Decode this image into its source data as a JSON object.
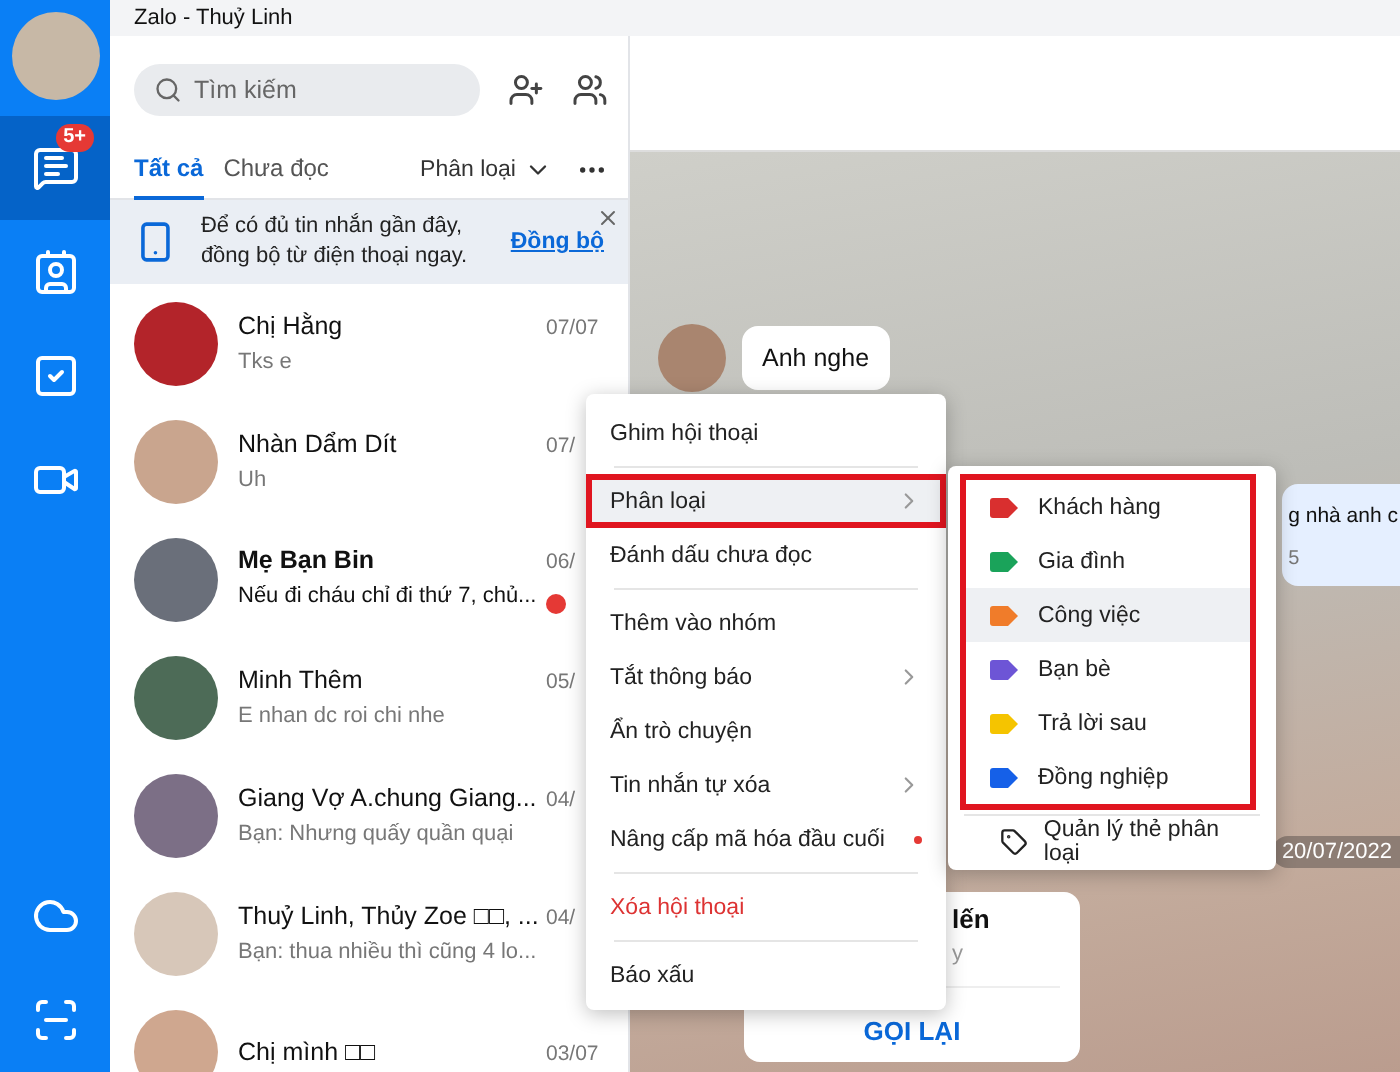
{
  "window": {
    "title": "Zalo - Thuỷ Linh"
  },
  "sidebar": {
    "items": [
      {
        "kind": "chat",
        "selected": true,
        "badge": "5+"
      },
      {
        "kind": "contacts",
        "selected": false
      },
      {
        "kind": "todo",
        "selected": false
      },
      {
        "kind": "video",
        "selected": false
      }
    ],
    "bottom_items": [
      {
        "kind": "cloud"
      },
      {
        "kind": "capture"
      }
    ]
  },
  "search": {
    "placeholder": "Tìm kiếm"
  },
  "tabs": [
    {
      "label": "Tất cả",
      "selected": true
    },
    {
      "label": "Chưa đọc",
      "selected": false
    }
  ],
  "filter": {
    "label": "Phân loại"
  },
  "sync_banner": {
    "text": "Để có đủ tin nhắn gần đây, đồng bộ từ điện thoại ngay.",
    "link": "Đồng bộ"
  },
  "conversations": [
    {
      "name": "Chị Hằng",
      "preview": "Tks e",
      "time": "07/07",
      "unread": false
    },
    {
      "name": "Nhàn Dẩm Dít",
      "preview": "Uh",
      "time": "07/",
      "unread": false
    },
    {
      "name": "Mẹ Bạn Bin",
      "preview": "Nếu đi cháu chỉ đi thứ 7, chủ...",
      "time": "06/",
      "unread": true
    },
    {
      "name": "Minh Thêm",
      "preview": "E nhan dc roi chi nhe",
      "time": "05/",
      "unread": false
    },
    {
      "name": "Giang Vợ A.chung Giang...",
      "preview": "Bạn: Nhưng quấy quần quại",
      "time": "04/",
      "unread": false
    },
    {
      "name": "Thuỷ Linh, Thủy Zoe □□, ...",
      "preview": "Bạn: thua nhiều thì cũng 4 lo...",
      "time": "04/",
      "unread": false
    },
    {
      "name": "Chị mình □□",
      "time": "03/07",
      "unread": false
    }
  ],
  "chat": {
    "incoming": "Anh nghe",
    "outgoing": "g nhà anh c",
    "outgoing_time": "5",
    "date": "20/07/2022",
    "call_card": {
      "title": "lến",
      "subtitle": "y",
      "action": "GỌI LẠI"
    }
  },
  "context_menu": {
    "groups": [
      [
        {
          "label": "Ghim hội thoại",
          "kind": "normal",
          "submenu": false,
          "selected": false,
          "framed": false,
          "new_dot": false
        }
      ],
      [
        {
          "label": "Phân loại",
          "kind": "normal",
          "submenu": true,
          "selected": true,
          "framed": true,
          "new_dot": false
        },
        {
          "label": "Đánh dấu chưa đọc",
          "kind": "normal",
          "submenu": false,
          "selected": false,
          "framed": false,
          "new_dot": false
        }
      ],
      [
        {
          "label": "Thêm vào nhóm",
          "kind": "normal",
          "submenu": false,
          "selected": false,
          "framed": false,
          "new_dot": false
        },
        {
          "label": "Tắt thông báo",
          "kind": "normal",
          "submenu": true,
          "selected": false,
          "framed": false,
          "new_dot": false
        },
        {
          "label": "Ẩn trò chuyện",
          "kind": "normal",
          "submenu": false,
          "selected": false,
          "framed": false,
          "new_dot": false
        },
        {
          "label": "Tin nhắn tự xóa",
          "kind": "normal",
          "submenu": true,
          "selected": false,
          "framed": false,
          "new_dot": false
        },
        {
          "label": "Nâng cấp mã hóa đầu cuối",
          "kind": "normal",
          "submenu": false,
          "selected": false,
          "framed": false,
          "new_dot": true
        }
      ],
      [
        {
          "label": "Xóa hội thoại",
          "kind": "danger",
          "submenu": false,
          "selected": false,
          "framed": false,
          "new_dot": false
        }
      ],
      [
        {
          "label": "Báo xấu",
          "kind": "normal",
          "submenu": false,
          "selected": false,
          "framed": false,
          "new_dot": false
        }
      ]
    ]
  },
  "tag_menu": {
    "framed": true,
    "tags": [
      {
        "label": "Khách hàng",
        "color": "#d92f2f",
        "selected": false
      },
      {
        "label": "Gia đình",
        "color": "#1aa35a",
        "selected": false
      },
      {
        "label": "Công việc",
        "color": "#f07c2a",
        "selected": true
      },
      {
        "label": "Bạn bè",
        "color": "#6d55d6",
        "selected": false
      },
      {
        "label": "Trả lời sau",
        "color": "#f5c400",
        "selected": false
      },
      {
        "label": "Đồng nghiệp",
        "color": "#1560e8",
        "selected": false
      }
    ],
    "manage": "Quản lý thẻ phân loại"
  }
}
